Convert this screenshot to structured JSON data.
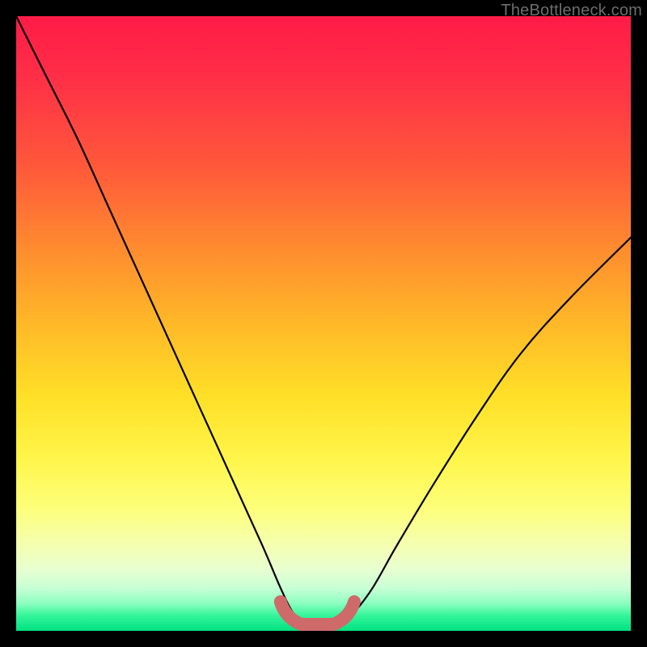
{
  "watermark": {
    "text": "TheBottleneck.com"
  },
  "colors": {
    "curve_stroke": "#000000",
    "minimum_stroke": "#cf6a6b",
    "background": "#000000"
  },
  "chart_data": {
    "type": "line",
    "title": "",
    "xlabel": "",
    "ylabel": "",
    "xlim": [
      0,
      100
    ],
    "ylim": [
      0,
      100
    ],
    "grid": false,
    "series": [
      {
        "name": "bottleneck-curve",
        "x": [
          0,
          5,
          10,
          15,
          20,
          25,
          30,
          35,
          40,
          43,
          45,
          47,
          49,
          51,
          53,
          55,
          58,
          62,
          68,
          75,
          82,
          90,
          100
        ],
        "y": [
          100,
          90,
          80,
          69,
          58,
          47,
          36,
          25,
          14,
          7,
          3,
          1,
          0,
          0,
          1,
          3,
          7,
          14,
          24,
          35,
          45,
          54,
          64
        ]
      }
    ],
    "minimum_marker": {
      "x_range": [
        43,
        55
      ],
      "y": 0,
      "style": "thick-rounded",
      "color": "#cf6a6b"
    }
  }
}
